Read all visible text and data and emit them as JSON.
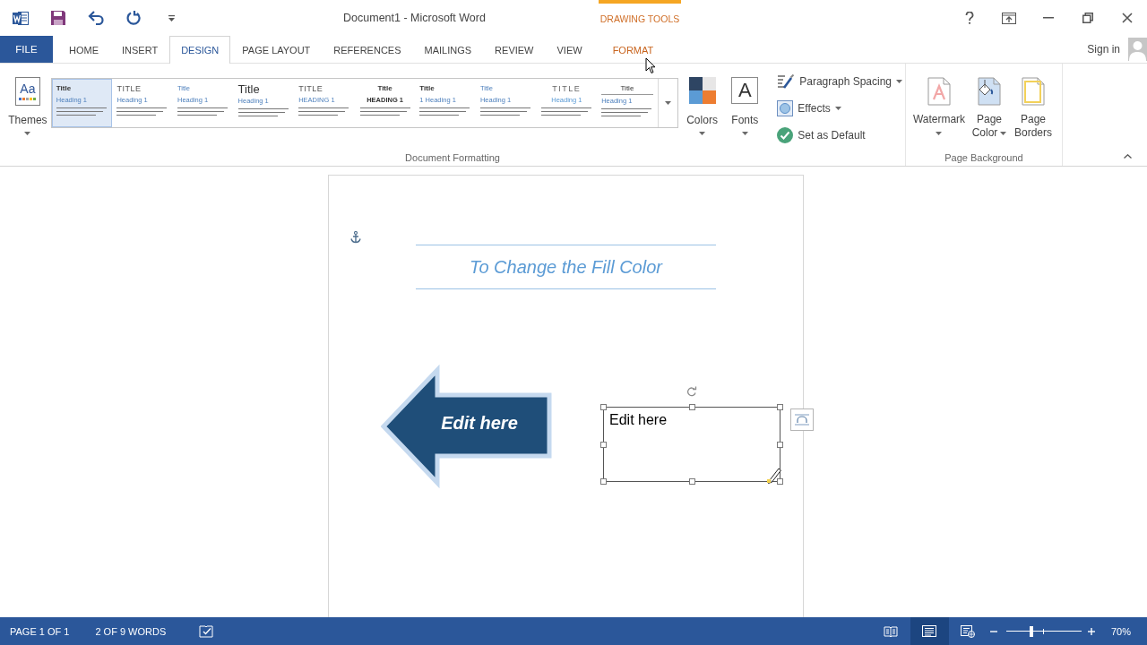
{
  "title_bar": {
    "title": "Document1 - Microsoft Word",
    "context_label": "DRAWING TOOLS"
  },
  "tabs": [
    {
      "label": "FILE",
      "kind": "file",
      "selected": false
    },
    {
      "label": "HOME",
      "kind": "standard",
      "selected": false
    },
    {
      "label": "INSERT",
      "kind": "standard",
      "selected": false
    },
    {
      "label": "DESIGN",
      "kind": "standard",
      "selected": true
    },
    {
      "label": "PAGE LAYOUT",
      "kind": "standard",
      "selected": false
    },
    {
      "label": "REFERENCES",
      "kind": "standard",
      "selected": false
    },
    {
      "label": "MAILINGS",
      "kind": "standard",
      "selected": false
    },
    {
      "label": "REVIEW",
      "kind": "standard",
      "selected": false
    },
    {
      "label": "VIEW",
      "kind": "standard",
      "selected": false
    },
    {
      "label": "FORMAT",
      "kind": "contextual",
      "selected": false
    }
  ],
  "account": {
    "label": "Sign in"
  },
  "ribbon": {
    "themes": {
      "glyph": "Aa",
      "label": "Themes"
    },
    "style_gallery": [
      {
        "kind": "basic",
        "title": "Title",
        "heading": "Heading 1",
        "selected": true
      },
      {
        "kind": "caps",
        "title": "TITLE",
        "heading": "Heading 1",
        "selected": false
      },
      {
        "kind": "blue",
        "title": "Title",
        "heading": "Heading 1",
        "selected": false
      },
      {
        "kind": "large",
        "title": "Title",
        "heading": "Heading 1",
        "selected": false
      },
      {
        "kind": "caps",
        "title": "TITLE",
        "heading": "HEADING 1",
        "selected": false
      },
      {
        "kind": "centered",
        "title": "Title",
        "heading": "HEADING 1",
        "selected": false
      },
      {
        "kind": "basic",
        "title": "Title",
        "heading": "1 Heading 1",
        "selected": false
      },
      {
        "kind": "blue",
        "title": "Title",
        "heading": "Heading 1",
        "selected": false
      },
      {
        "kind": "spaced",
        "title": "TITLE",
        "heading": "Heading 1",
        "selected": false
      },
      {
        "kind": "underlined",
        "title": "Title",
        "heading": "Heading 1",
        "selected": false
      }
    ],
    "colors": {
      "label": "Colors"
    },
    "fonts": {
      "glyph": "A",
      "label": "Fonts"
    },
    "formatting_options": [
      {
        "kind": "paragraph_spacing",
        "label": "Paragraph Spacing",
        "dropdown": true
      },
      {
        "kind": "effects",
        "label": "Effects",
        "dropdown": true
      },
      {
        "kind": "set_default",
        "label": "Set as Default",
        "dropdown": false
      }
    ],
    "document_formatting_label": "Document Formatting",
    "page_background": {
      "buttons": [
        {
          "kind": "watermark",
          "lines": [
            "Watermark"
          ],
          "dropdown": true
        },
        {
          "kind": "page_color",
          "lines": [
            "Page",
            "Color"
          ],
          "dropdown": true
        },
        {
          "kind": "page_borders",
          "lines": [
            "Page",
            "Borders"
          ],
          "dropdown": false
        }
      ],
      "label": "Page Background"
    }
  },
  "document": {
    "heading": "To Change the Fill Color",
    "shapes": [
      {
        "kind": "arrow",
        "text": "Edit here",
        "selected": false
      },
      {
        "kind": "text_box",
        "text": "Edit here",
        "selected": true
      }
    ]
  },
  "status_bar": {
    "page": "PAGE 1 OF 1",
    "words": "2 OF 9 WORDS",
    "views": [
      {
        "kind": "read_mode",
        "selected": false
      },
      {
        "kind": "print_layout",
        "selected": true
      },
      {
        "kind": "web_layout",
        "selected": false
      }
    ],
    "zoom": {
      "level": 0.33,
      "reading": "70%"
    }
  }
}
